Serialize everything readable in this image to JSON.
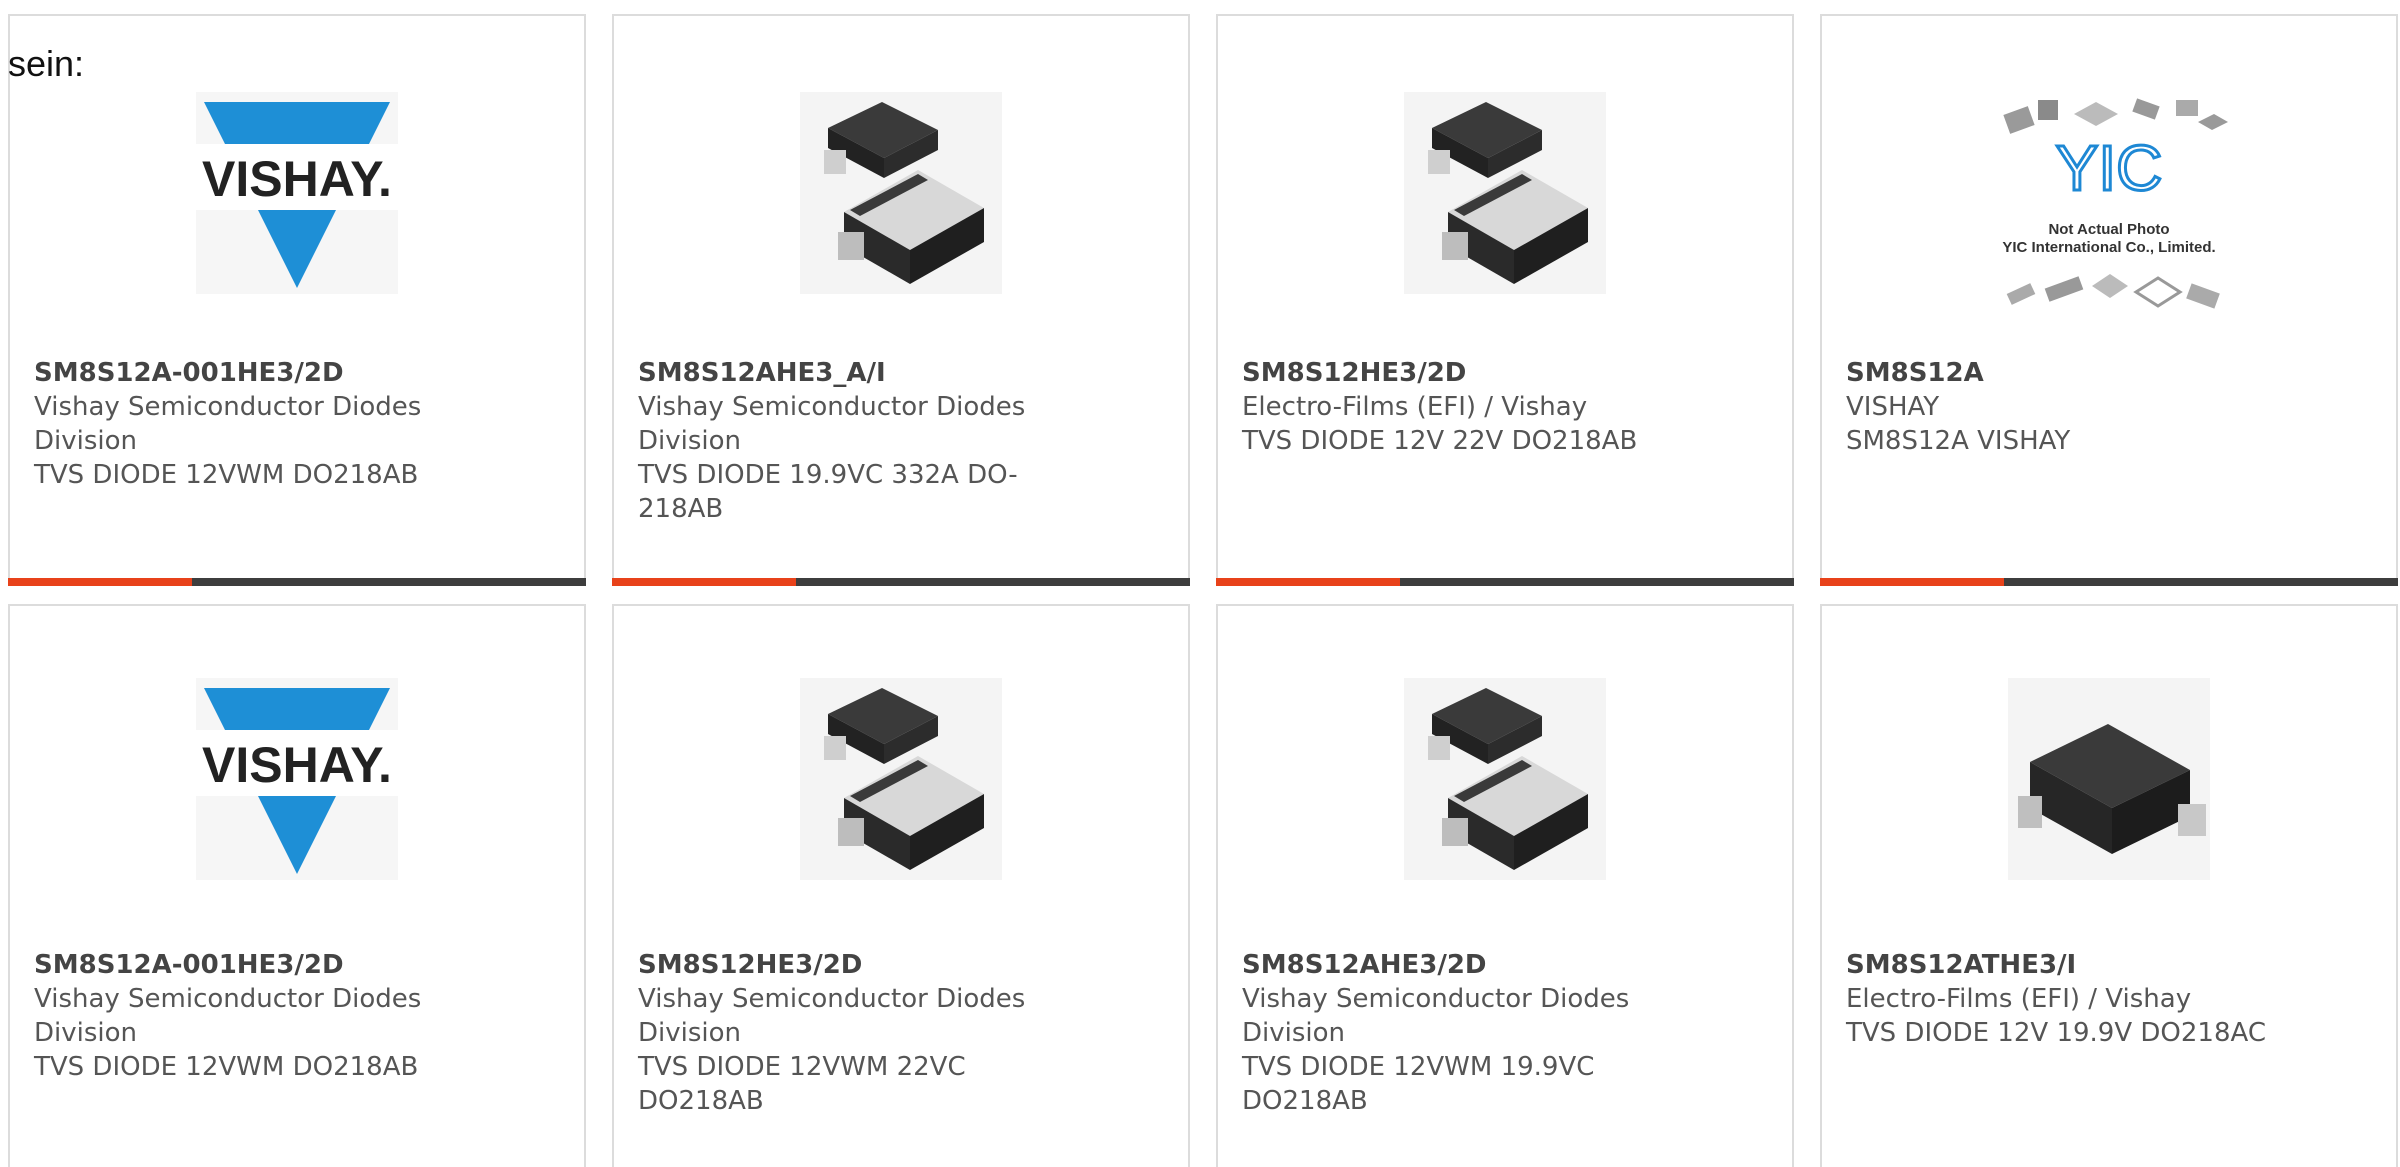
{
  "intro_text": "sein:",
  "colors": {
    "accent": "#e8421a",
    "bar": "#3d3d3d",
    "vishay_blue": "#1e8fd6",
    "yic_blue": "#1e88d4"
  },
  "cards": [
    {
      "image_icon": "vishay-logo",
      "logo_text": "VISHAY.",
      "part_number": "SM8S12A-001HE3/2D",
      "manufacturer": "Vishay Semiconductor Diodes Division",
      "description": "TVS DIODE 12VWM DO218AB"
    },
    {
      "image_icon": "diode-package-image",
      "part_number": "SM8S12AHE3_A/I",
      "manufacturer": "Vishay Semiconductor Diodes Division",
      "description": "TVS DIODE 19.9VC 332A DO-218AB"
    },
    {
      "image_icon": "diode-package-image",
      "part_number": "SM8S12HE3/2D",
      "manufacturer": "Electro-Films (EFI) / Vishay",
      "description": "TVS DIODE 12V 22V DO218AB"
    },
    {
      "image_icon": "yic-placeholder-image",
      "logo_text": "YIC",
      "caption_line1": "Not Actual Photo",
      "caption_line2": "YIC International Co., Limited.",
      "part_number": "SM8S12A",
      "manufacturer": "VISHAY",
      "description": "SM8S12A VISHAY"
    },
    {
      "image_icon": "vishay-logo",
      "logo_text": "VISHAY.",
      "part_number": "SM8S12A-001HE3/2D",
      "manufacturer": "Vishay Semiconductor Diodes Division",
      "description": "TVS DIODE 12VWM DO218AB"
    },
    {
      "image_icon": "diode-package-image",
      "part_number": "SM8S12HE3/2D",
      "manufacturer": "Vishay Semiconductor Diodes Division",
      "description": "TVS DIODE 12VWM 22VC DO218AB"
    },
    {
      "image_icon": "diode-package-image",
      "part_number": "SM8S12AHE3/2D",
      "manufacturer": "Vishay Semiconductor Diodes Division",
      "description": "TVS DIODE 12VWM 19.9VC DO218AB"
    },
    {
      "image_icon": "smd-diode-image",
      "part_number": "SM8S12ATHE3/I",
      "manufacturer": "Electro-Films (EFI) / Vishay",
      "description": "TVS DIODE 12V 19.9V DO218AC"
    }
  ]
}
